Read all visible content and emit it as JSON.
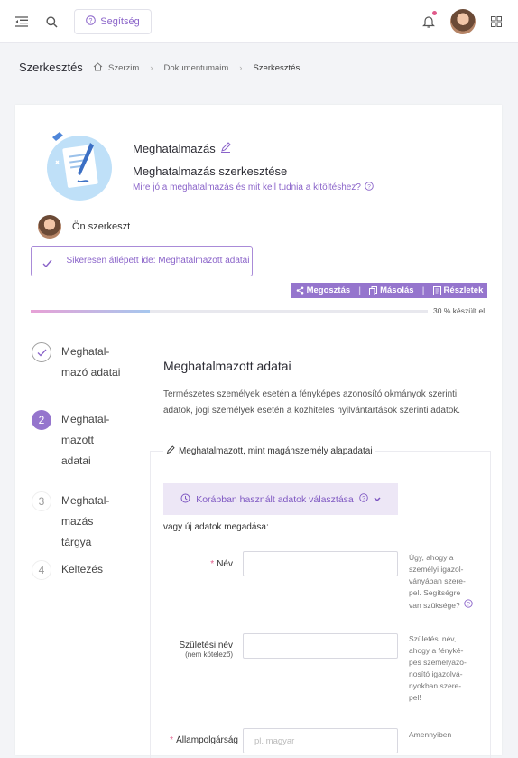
{
  "topbar": {
    "help_label": "Segítség",
    "icons": [
      "menu-collapse-icon",
      "search-icon",
      "help-icon",
      "bell-icon",
      "apps-grid-icon"
    ]
  },
  "breadcrumb": {
    "page_title": "Szerkesztés",
    "items": [
      "Szerzim",
      "Dokumentumaim",
      "Szerkesztés"
    ]
  },
  "document": {
    "title": "Meghatalmazás",
    "subtitle": "Meghatalmazás szerkesztése",
    "help_link": "Mire jó a meghatalmazás és mit kell tudnia a kitöltéshez?"
  },
  "editor": {
    "label": "Ön szerkeszt"
  },
  "notice": {
    "text": "Sikeresen átlépett ide: Meghatalmazott adatai"
  },
  "actions": {
    "share": "Megosztás",
    "copy": "Másolás",
    "details": "Részletek"
  },
  "progress": {
    "percent": 30,
    "label": "30 % készült el"
  },
  "steps": [
    {
      "number": "1",
      "label_lines": [
        "Meghatal-",
        "mazó adatai"
      ],
      "state": "done"
    },
    {
      "number": "2",
      "label_lines": [
        "Meghatal-",
        "mazott",
        "adatai"
      ],
      "state": "active"
    },
    {
      "number": "3",
      "label_lines": [
        "Meghatal-",
        "mazás",
        "tárgya"
      ],
      "state": "pending"
    },
    {
      "number": "4",
      "label_lines": [
        "Keltezés"
      ],
      "state": "pending"
    }
  ],
  "section": {
    "title": "Meghatalmazott adatai",
    "description": "Természetes személyek esetén a fényképes azonosító okmányok szerinti adatok, jogi személyek esetén a közhiteles nyilvántartások szerinti adatok.",
    "legend": "Meghatalmazott, mint magánszemély alapadatai",
    "prev_data_button": "Korábban használt adatok választása",
    "or_text": "vagy új adatok megadása:"
  },
  "fields": [
    {
      "label": "Név",
      "required": true,
      "sublabel": "",
      "placeholder": "",
      "hint_lines": [
        "Úgy, ahogy a",
        "személyi igazol-",
        "ványában szere-",
        "pel. Segítségre",
        "van szüksége?"
      ]
    },
    {
      "label": "Születési név",
      "required": false,
      "sublabel": "(nem kötelező)",
      "placeholder": "",
      "hint_lines": [
        "Születési név,",
        "ahogy a fényké-",
        "pes személyazo-",
        "nosító igazolvá-",
        "nyokban szere-",
        "pel!"
      ]
    },
    {
      "label": "Állampolgárság",
      "required": true,
      "sublabel": "",
      "placeholder": "pl. magyar",
      "hint_lines": [
        "Amennyiben"
      ]
    }
  ],
  "colors": {
    "accent": "#8a63c9",
    "accent_bar": "#9575cd",
    "required": "#e05a8a"
  }
}
